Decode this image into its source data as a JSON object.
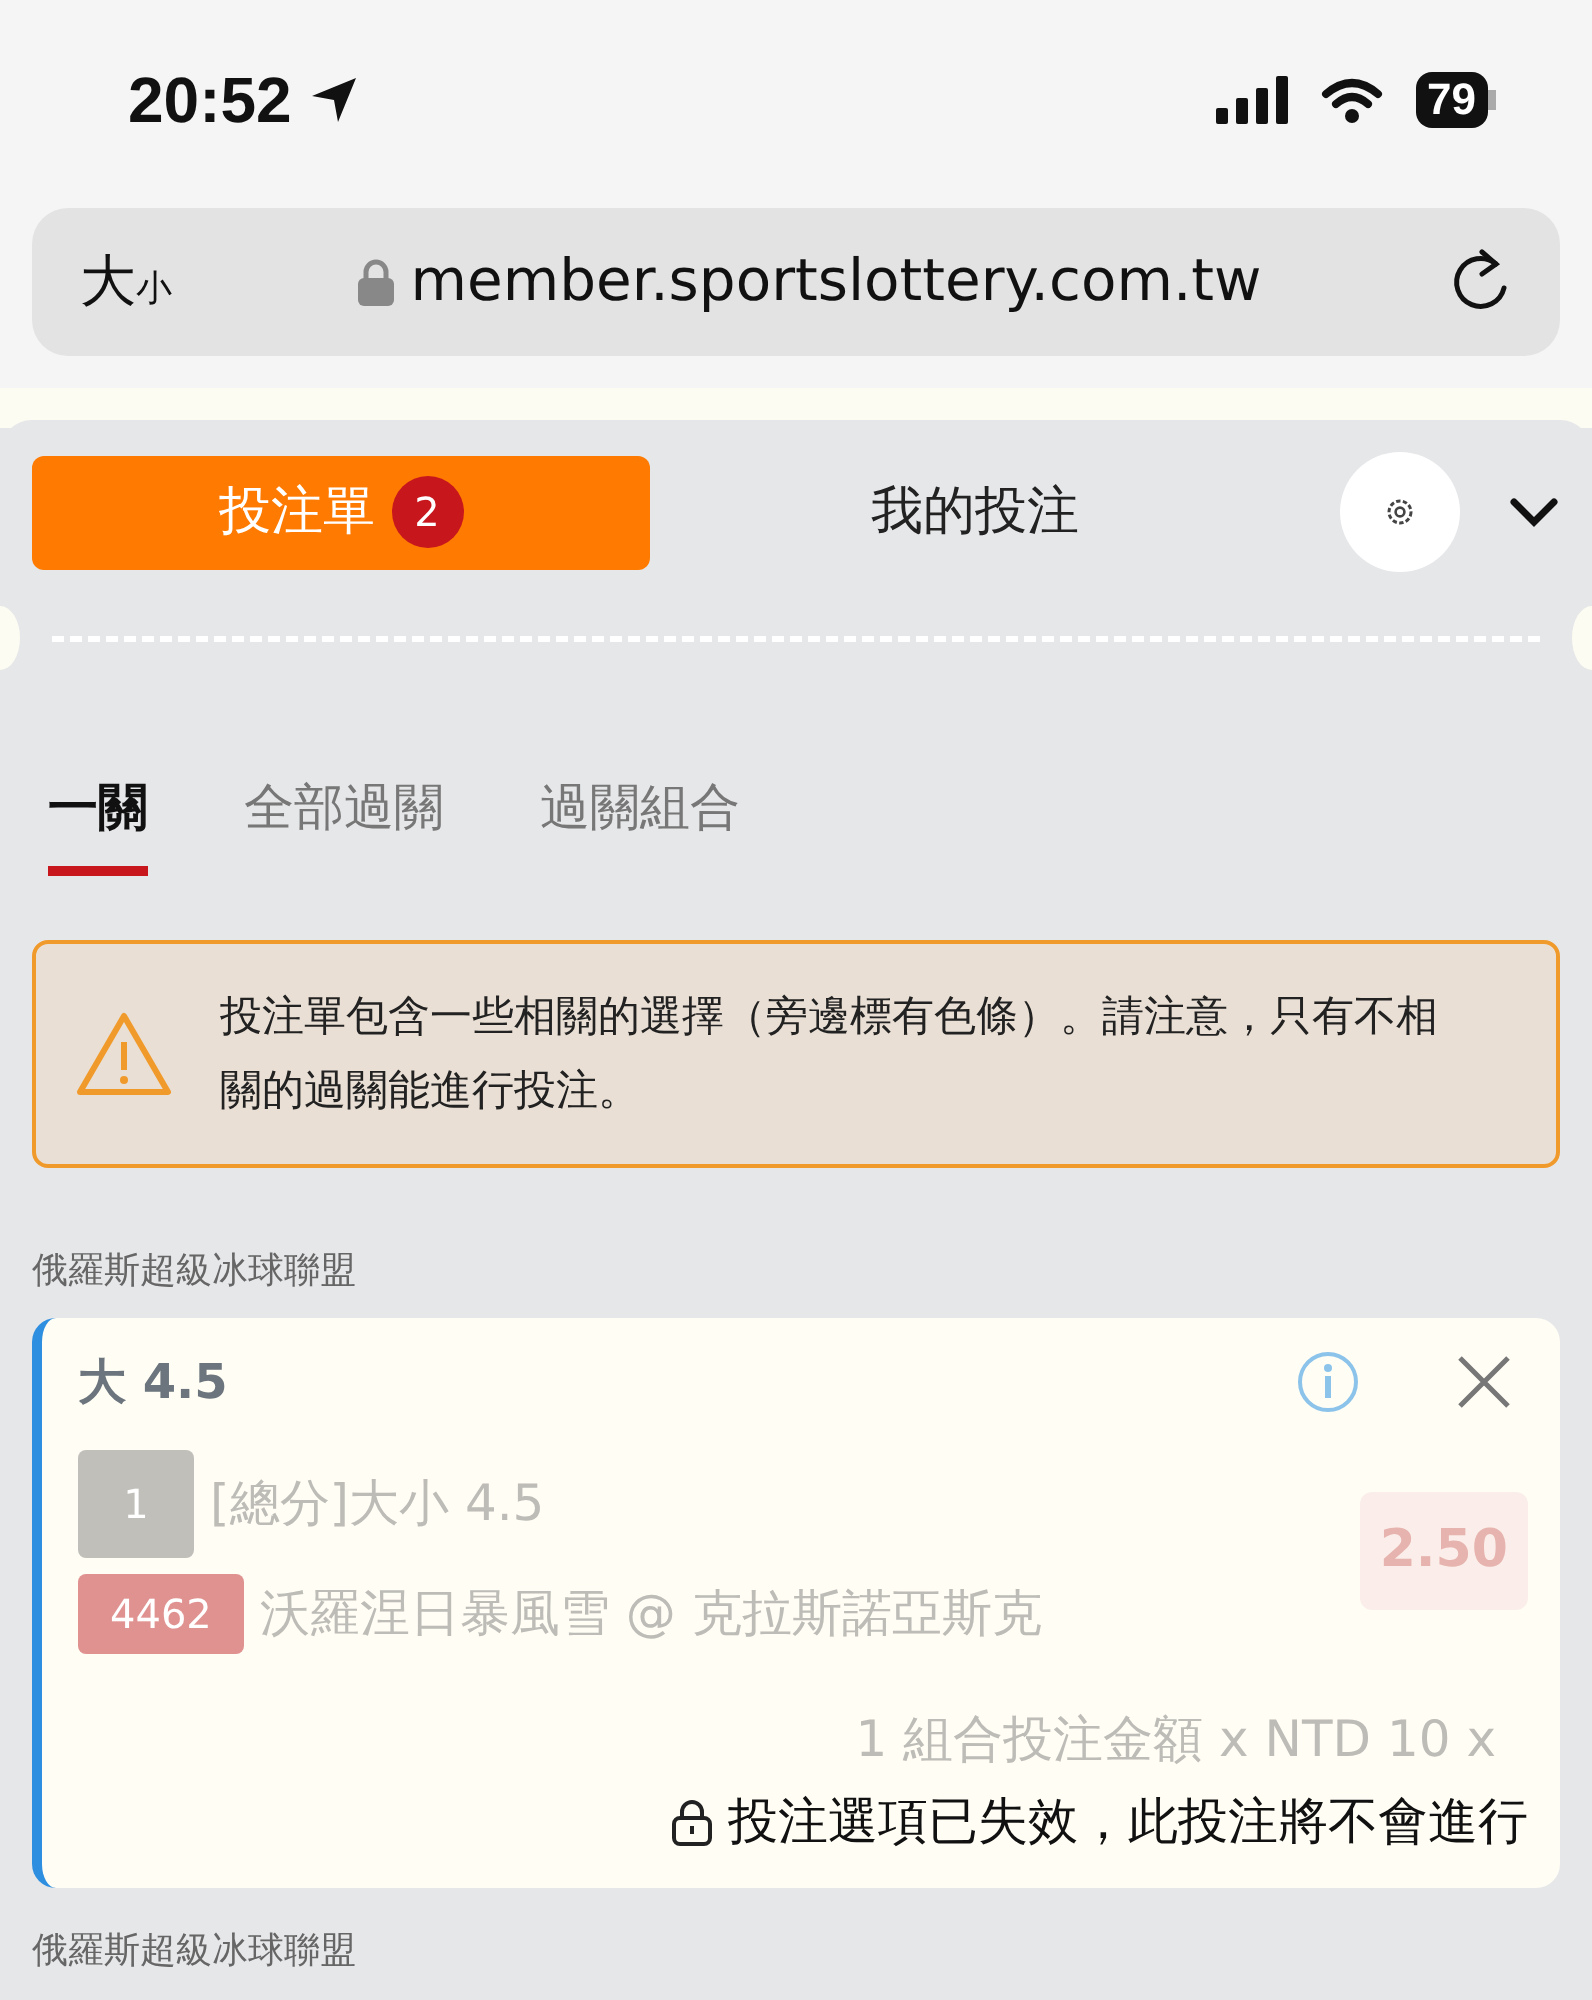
{
  "status_bar": {
    "time": "20:52",
    "battery": "79"
  },
  "browser": {
    "text_size_large": "大",
    "text_size_small": "小",
    "url": "member.sportslottery.com.tw"
  },
  "header_tabs": [
    {
      "label": "投注單",
      "selected": true,
      "badge": "2"
    },
    {
      "label": "我的投注",
      "selected": false
    }
  ],
  "sub_tabs": [
    {
      "label": "一關",
      "selected": true
    },
    {
      "label": "全部過關",
      "selected": false
    },
    {
      "label": "過關組合",
      "selected": false
    }
  ],
  "alert": {
    "text": "投注單包含一些相關的選擇（旁邊標有色條）。請注意，只有不相關的過關能進行投注。"
  },
  "groups": [
    {
      "league": "俄羅斯超級冰球聯盟",
      "bets": [
        {
          "title": "大 4.5",
          "suspended": true,
          "lines": [
            {
              "badge": "1",
              "color": "#c0bfba",
              "text": "[總分]大小 4.5"
            },
            {
              "badge": "4462",
              "color": "#e09290",
              "text": "沃羅涅日暴風雪 @ 克拉斯諾亞斯克"
            }
          ],
          "odds": "2.50",
          "stake": "1 組合投注金額 x NTD 10 x",
          "notice": "投注選項已失效，此投注將不會進行"
        }
      ]
    },
    {
      "league": "俄羅斯超級冰球聯盟"
    }
  ]
}
